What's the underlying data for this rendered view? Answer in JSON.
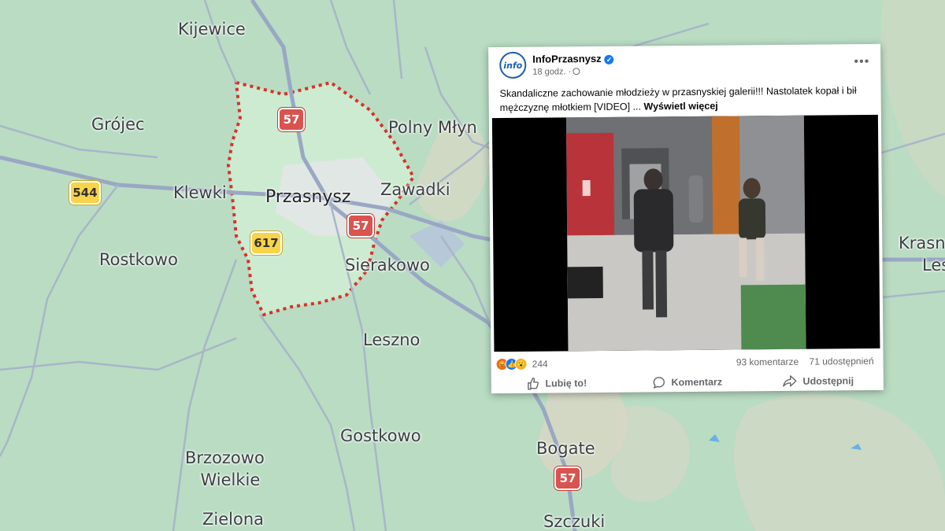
{
  "map": {
    "places": {
      "kijewice": "Kijewice",
      "grojec": "Grójec",
      "polny_mlyn": "Polny Młyn",
      "klewki": "Klewki",
      "przasnysz": "Przasnysz",
      "zawadki": "Zawadki",
      "rostkowo": "Rostkowo",
      "sierakowo": "Sierakowo",
      "leszno": "Leszno",
      "gostkowo": "Gostkowo",
      "brzozowo_line1": "Brzozowo",
      "brzozowo_line2": "Wielkie",
      "zielona": "Zielona",
      "bogate": "Bogate",
      "szczuki": "Szczuki",
      "krasne_line1": "Krasn",
      "krasne_line2": "Les"
    },
    "roads": {
      "r57a": "57",
      "r57b": "57",
      "r57c": "57",
      "r544": "544",
      "r617": "617"
    },
    "colors": {
      "land": "#b9dcc3",
      "boundary": "#d8312a",
      "road": "#9aa7c4"
    }
  },
  "post": {
    "page_name": "InfoPrzasnysz",
    "avatar_text": "info",
    "time": "18 godz. ·",
    "text": "Skandaliczne zachowanie młodzieży w przasnyskiej galerii!!! Nastolatek kopał i bił mężczyznę młotkiem [VIDEO] ...",
    "see_more": "Wyświetl więcej",
    "reaction_count": "244",
    "comments": "93 komentarze",
    "shares": "71 udostępnień",
    "actions": {
      "like": "Lubię to!",
      "comment": "Komentarz",
      "share": "Udostępnij"
    }
  }
}
